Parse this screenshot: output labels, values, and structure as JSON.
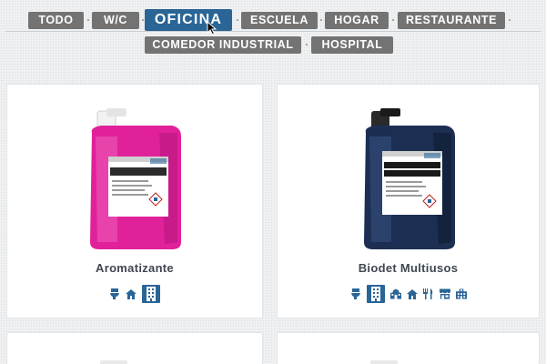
{
  "filters": [
    {
      "label": "TODO",
      "active": false
    },
    {
      "label": "W/C",
      "active": false
    },
    {
      "label": "OFICINA",
      "active": true
    },
    {
      "label": "ESCUELA",
      "active": false
    },
    {
      "label": "HOGAR",
      "active": false
    },
    {
      "label": "RESTAURANTE",
      "active": false
    },
    {
      "label": "COMEDOR INDUSTRIAL",
      "active": false
    },
    {
      "label": "HOSPITAL",
      "active": false
    }
  ],
  "products": [
    {
      "name": "Aromatizante",
      "bottle_color": "#e0219a",
      "bottle_label_title": "Aromatizante",
      "icons": [
        "toilet-icon",
        "house-icon",
        "office-building-icon"
      ],
      "active_icon": "office-building-icon"
    },
    {
      "name": "Biodet Multiusos",
      "bottle_color": "#1c2f52",
      "bottle_label_title": "BIODET MULTIUSOS",
      "icons": [
        "toilet-icon",
        "office-building-icon",
        "school-icon",
        "house-icon",
        "restaurant-icon",
        "storefront-icon",
        "hospital-icon"
      ],
      "active_icon": "office-building-icon"
    }
  ],
  "colors": {
    "filter_inactive": "#737373",
    "filter_active": "#2a6596",
    "icon": "#2a6596",
    "product_title": "#3f4750"
  }
}
